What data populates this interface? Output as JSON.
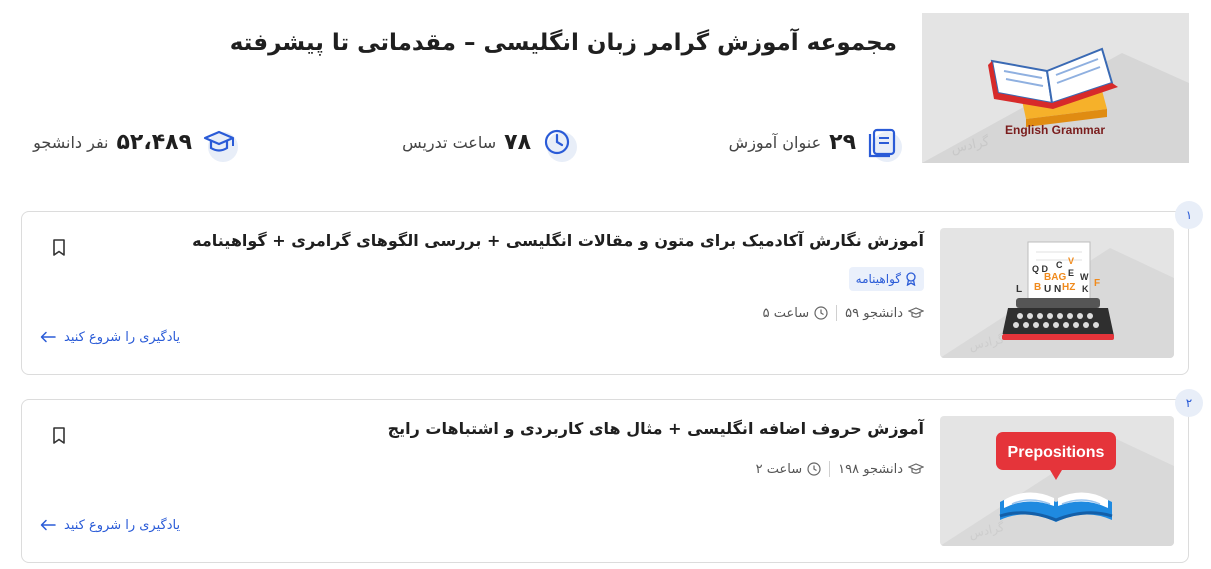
{
  "header": {
    "title": "مجموعه آموزش گرامر زبان انگلیسی – مقدماتی تا پیشرفته",
    "image_caption": "English Grammar",
    "watermark": "گرادس"
  },
  "stats": {
    "titles": {
      "value": "۲۹",
      "unit": "عنوان آموزش",
      "icon": "book-stack-icon"
    },
    "hours": {
      "value": "۷۸",
      "unit": "ساعت تدریس",
      "icon": "clock-icon"
    },
    "students": {
      "value": "۵۲،۴۸۹",
      "unit": "نفر دانشجو",
      "icon": "graduation-cap-icon"
    }
  },
  "courses": [
    {
      "index": "۱",
      "title": "آموزش نگارش آکادمیک برای متون و مقالات انگلیسی + بررسی الگوهای گرامری + گواهینامه",
      "certificate_label": "گواهینامه",
      "students": "۵۹ دانشجو",
      "duration": "۵ ساعت",
      "start_label": "یادگیری را شروع کنید"
    },
    {
      "index": "۲",
      "title": "آموزش حروف اضافه انگلیسی + مثال های کاربردی و اشتباهات رایج",
      "thumb_caption": "Prepositions",
      "students": "۱۹۸ دانشجو",
      "duration": "۲ ساعت",
      "start_label": "یادگیری را شروع کنید"
    }
  ],
  "colors": {
    "accent": "#2a5bd7",
    "badge_bg": "#e8eef8",
    "thumb_bg": "#e4e4e4",
    "prepositions_red": "#e5343a"
  }
}
